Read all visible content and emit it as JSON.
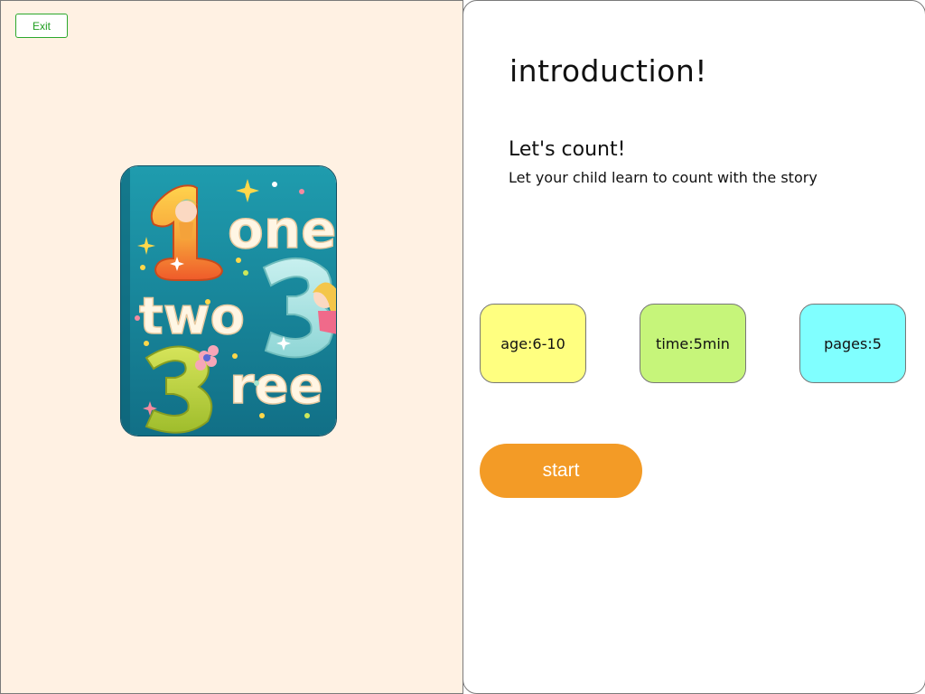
{
  "exit_label": "Exit",
  "cover": {
    "lettering": [
      "1",
      "one",
      "two",
      "3",
      "3",
      "ree"
    ]
  },
  "intro": {
    "heading": "introduction!",
    "title": "Let's count!",
    "description": "Let your child learn to count with the story"
  },
  "info": {
    "age": "age:6-10",
    "time": "time:5min",
    "pages": "pages:5"
  },
  "start_label": "start",
  "colors": {
    "left_panel_bg": "#fff1e3",
    "exit_green": "#2ca82c",
    "age_tile": "#ffff80",
    "time_tile": "#c6f57a",
    "pages_tile": "#80ffff",
    "start_button": "#f39b26",
    "cover_teal": "#1f8fa3"
  }
}
